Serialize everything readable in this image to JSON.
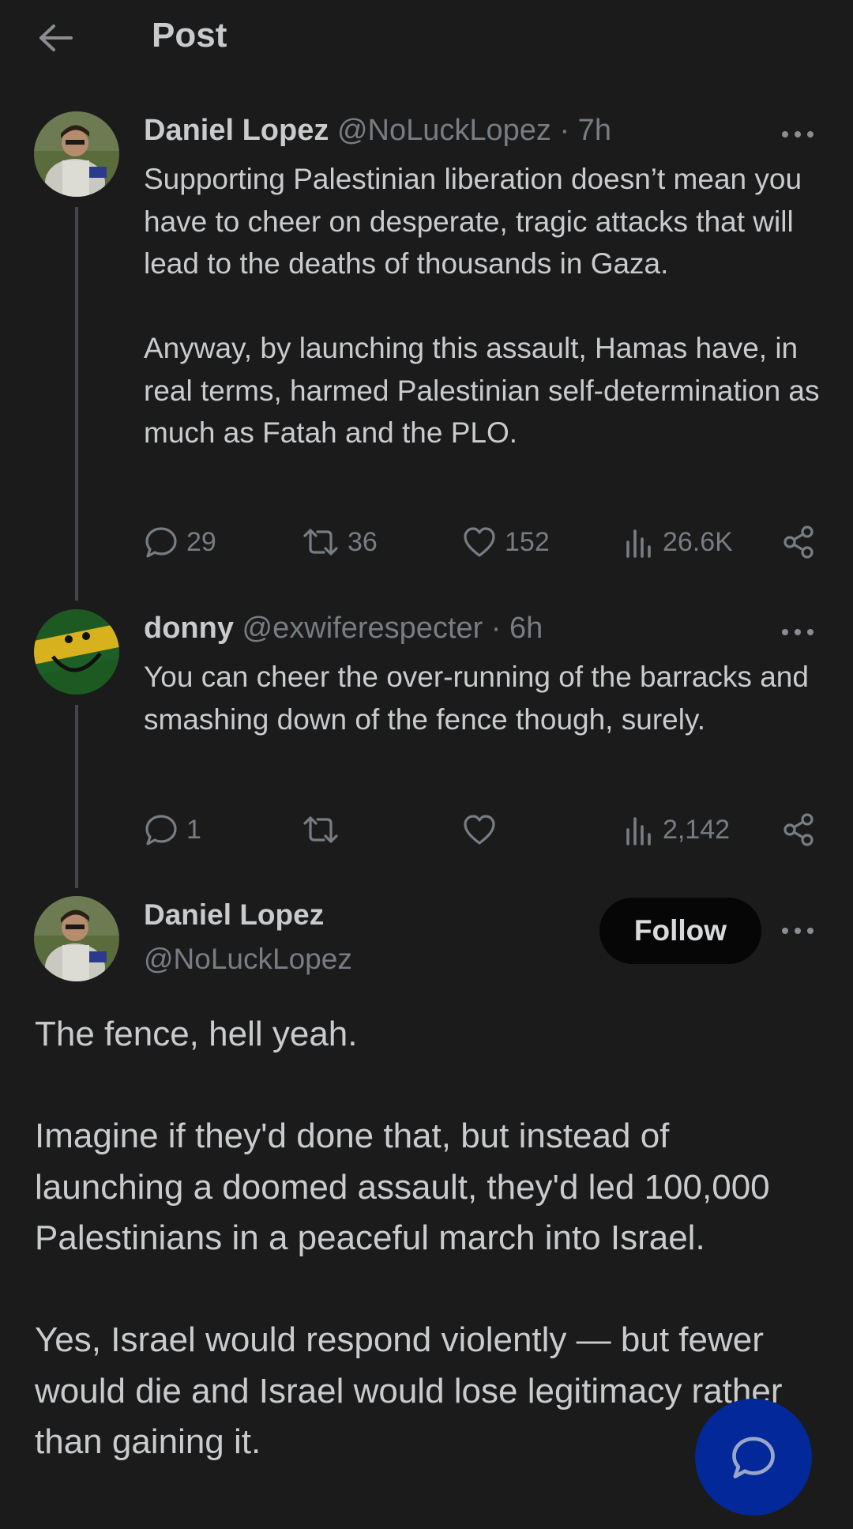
{
  "header": {
    "title": "Post"
  },
  "thread": [
    {
      "name": "Daniel Lopez",
      "handle": "@NoLuckLopez",
      "time": "· 7h",
      "text": "Supporting Palestinian liberation doesn’t mean you have to cheer on desperate, tragic attacks that will lead to the deaths of thousands in Gaza.\n\nAnyway, by launching this assault, Hamas have, in real terms, harmed Palestinian self-determination as much as Fatah and the PLO.",
      "replies": "29",
      "reposts": "36",
      "likes": "152",
      "views": "26.6K"
    },
    {
      "name": "donny",
      "handle": "@exwiferespecter",
      "time": "· 6h",
      "text": "You can cheer the over-running of the barracks and smashing down of the fence though, surely.",
      "replies": "1",
      "reposts": "",
      "likes": "",
      "views": "2,142"
    }
  ],
  "focused": {
    "name": "Daniel Lopez",
    "handle": "@NoLuckLopez",
    "follow_label": "Follow",
    "text": "The fence, hell yeah.\n\nImagine if they'd done that, but instead of launching a doomed assault, they'd led 100,000 Palestinians in a peaceful march into Israel.\n\nYes, Israel would respond violently — but fewer would die and Israel would lose legitimacy rather than gaining it."
  },
  "icons": {
    "back": "arrow-left-icon",
    "more": "more-horizontal-icon",
    "reply": "reply-icon",
    "repost": "repost-icon",
    "like": "heart-icon",
    "views": "views-icon",
    "share": "share-icon",
    "compose": "compose-reply-icon"
  },
  "colors": {
    "background": "#1b1b1c",
    "text": "#c9cbcd",
    "muted": "#787d83",
    "fab": "#02289a"
  }
}
